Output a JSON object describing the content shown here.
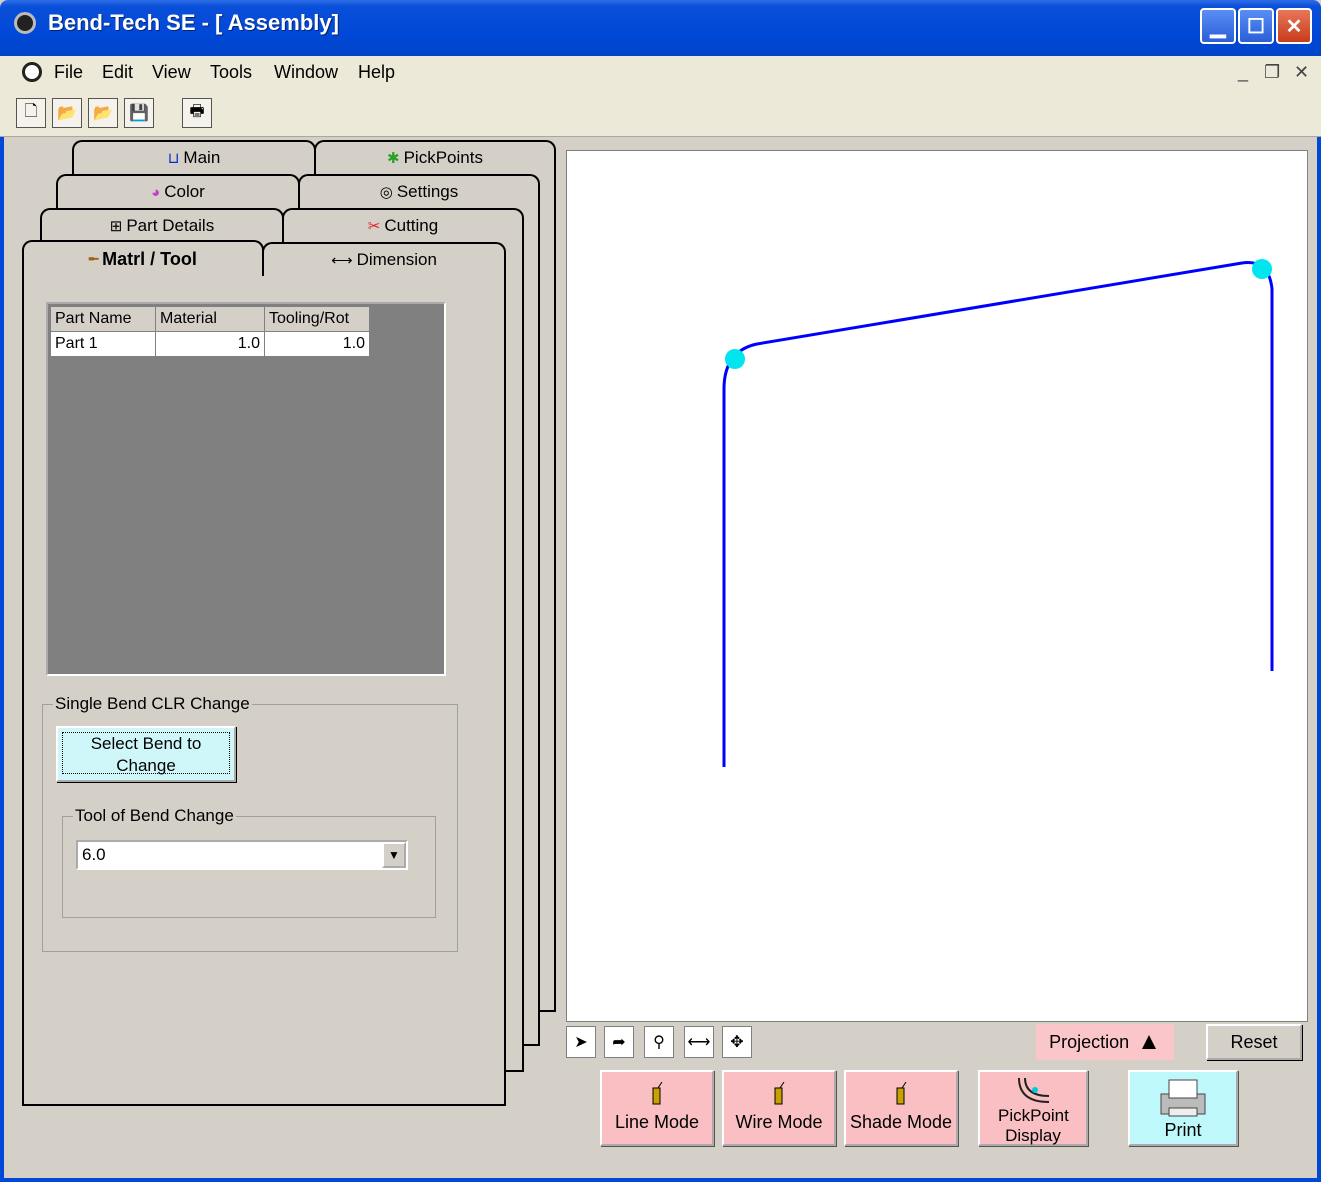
{
  "window": {
    "title": "Bend-Tech SE - [ Assembly]"
  },
  "menu": [
    "File",
    "Edit",
    "View",
    "Tools",
    "Window",
    "Help"
  ],
  "mdi_controls": [
    "_",
    "❐",
    "✕"
  ],
  "toolbar": {
    "icons": [
      "new-file-icon",
      "open-folder-icon",
      "open-assembly-icon",
      "save-icon",
      "print-icon"
    ]
  },
  "tabs": {
    "row1": [
      "Main",
      "PickPoints"
    ],
    "row2": [
      "Color",
      "Settings"
    ],
    "row3": [
      "Part Details",
      "Cutting"
    ],
    "row4": [
      "Matrl / Tool",
      "Dimension"
    ]
  },
  "grid": {
    "headers": [
      "Part Name",
      "Material",
      "Tooling/Rot"
    ],
    "rows": [
      [
        "Part 1",
        "1.0",
        "1.0"
      ]
    ]
  },
  "single_bend": {
    "legend": "Single Bend CLR Change",
    "button": "Select Bend to Change",
    "tool_legend": "Tool of Bend Change",
    "tool_value": "6.0"
  },
  "view": {
    "projection_label": "Projection",
    "reset_label": "Reset",
    "modes": [
      "Line Mode",
      "Wire Mode",
      "Shade Mode",
      "PickPoint Display",
      "Print"
    ],
    "line_color": "#0000ff",
    "pickpoint_color": "#00e5ee"
  }
}
